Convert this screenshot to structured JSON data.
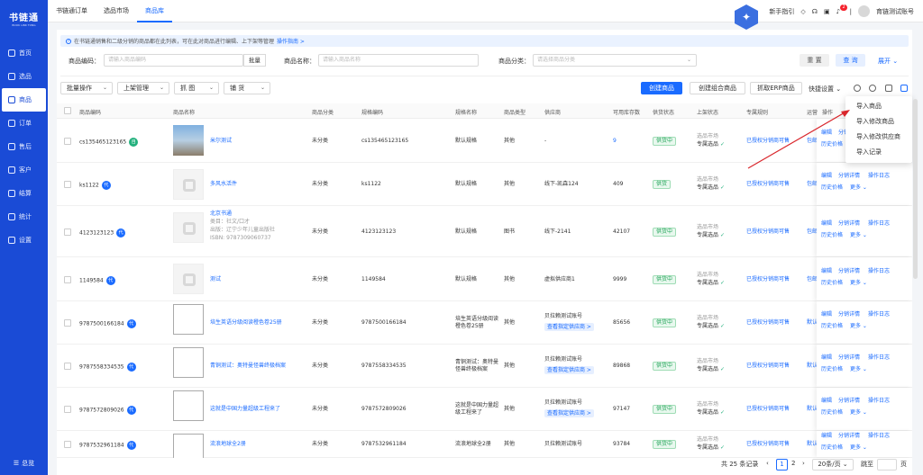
{
  "sidebar": {
    "logo_title": "书链通",
    "logo_sub": "BOOK LINK TONG",
    "items": [
      {
        "label": "首页",
        "icon": "home-icon"
      },
      {
        "label": "选品",
        "icon": "select-icon"
      },
      {
        "label": "商品",
        "icon": "goods-icon"
      },
      {
        "label": "订单",
        "icon": "order-icon"
      },
      {
        "label": "售后",
        "icon": "aftersale-icon"
      },
      {
        "label": "客户",
        "icon": "customer-icon"
      },
      {
        "label": "结算",
        "icon": "settle-icon"
      },
      {
        "label": "统计",
        "icon": "stats-icon"
      },
      {
        "label": "设置",
        "icon": "settings-icon"
      }
    ],
    "active": "商品",
    "bottom_label": "总览"
  },
  "topbar": {
    "tabs": [
      "书链通订单",
      "选品市场",
      "商品库"
    ],
    "active_tab": "商品库",
    "guide": "新手指引",
    "badge": "2",
    "account": "育链测试账号"
  },
  "notice": {
    "text": "在书链通销售和二级分销的商品都在此列表，可在此对商品进行编辑、上下架等管理",
    "link": "操作指南 >"
  },
  "filters": {
    "code_label": "商品编码：",
    "code_placeholder": "请输入商品编码",
    "batch": "批量",
    "name_label": "商品名称：",
    "name_placeholder": "请输入商品名称",
    "cat_label": "商品分类：",
    "cat_placeholder": "请选择商品分类",
    "reset": "重 置",
    "query": "查 询",
    "expand": "展开"
  },
  "toolbar": {
    "batch_ops": "批量操作",
    "shelf": "上架管理",
    "grab": "抓 图",
    "copy": "铺 货",
    "create": "创建商品",
    "create_combo": "创建组合商品",
    "grab_erp": "抓取ERP商品",
    "quick": "快捷设置"
  },
  "table": {
    "headers": [
      "商品编码",
      "商品名称",
      "商品分类",
      "规格编码",
      "规格名称",
      "商品类型",
      "供应商",
      "可用库存数",
      "供货状态",
      "上架状态",
      "专属规则",
      "运营",
      "操作"
    ],
    "rows": [
      {
        "code": "cs135465123165",
        "dai": "自",
        "dai_color": "green",
        "thumb": "real",
        "name": "米尔测试",
        "cat": "未分类",
        "spec_code": "cs135465123165",
        "spec": "默认规格",
        "type": "其他",
        "supplier": "-",
        "supplier_tag": "",
        "stock": "9",
        "stock_link": true,
        "status": "供货中",
        "shelf1": "选品市场",
        "shelf2": "专属选品",
        "rule": "已授权分销商可售",
        "op_extra": "包邮"
      },
      {
        "code": "ks1122",
        "dai": "代",
        "thumb": "gray",
        "name": "多风水活件",
        "cat": "未分类",
        "spec_code": "ks1122",
        "spec": "默认规格",
        "type": "其他",
        "supplier": "线下-凯森124",
        "supplier_tag": "",
        "stock": "409",
        "status": "供货",
        "shelf1": "选品市场",
        "shelf2": "专属选品",
        "rule": "已授权分销商可售",
        "op_extra": "包邮"
      },
      {
        "code": "4123123123",
        "dai": "代",
        "thumb": "gray",
        "name": "北京书通",
        "name_sub": [
          "类目：社文/口才",
          "出版：辽宁少年儿童出版社",
          "ISBN: 9787309060737"
        ],
        "cat": "未分类",
        "spec_code": "4123123123",
        "spec": "默认规格",
        "type": "图书",
        "supplier": "线下-2141",
        "supplier_tag": "",
        "stock": "42107",
        "status": "供货中",
        "shelf1": "选品市场",
        "shelf2": "专属选品",
        "rule": "已授权分销商可售",
        "op_extra": "包邮"
      },
      {
        "code": "1149584",
        "dai": "代",
        "thumb": "gray",
        "name": "测试",
        "cat": "未分类",
        "spec_code": "1149584",
        "spec": "默认规格",
        "type": "其他",
        "supplier": "虚拟供应商1",
        "supplier_tag": "",
        "stock": "9999",
        "status": "供货中",
        "shelf1": "选品市场",
        "shelf2": "专属选品",
        "rule": "已授权分销商可售",
        "op_extra": "包邮"
      },
      {
        "code": "9787500166184",
        "dai": "代",
        "thumb": "broken",
        "name": "培生英语分级阅读橙色卷25册",
        "cat": "未分类",
        "spec_code": "9787500166184",
        "spec": "培生英语分级阅读橙色卷25册",
        "type": "其他",
        "supplier": "贝拉赖测试账号",
        "supplier_tag": "查看指定供应商 >",
        "stock": "85656",
        "status": "供货中",
        "shelf1": "选品市场",
        "shelf2": "专属选品",
        "rule": "已授权分销商可售",
        "op_extra": "默认"
      },
      {
        "code": "9787558334535",
        "dai": "代",
        "thumb": "broken",
        "name": "青铜测试：奥特曼怪兽终极档案",
        "cat": "未分类",
        "spec_code": "9787558334535",
        "spec": "青铜测试：奥特曼怪兽终极档案",
        "type": "其他",
        "supplier": "贝拉赖测试账号",
        "supplier_tag": "查看指定供应商 >",
        "stock": "89868",
        "status": "供货中",
        "shelf1": "选品市场",
        "shelf2": "专属选品",
        "rule": "已授权分销商可售",
        "op_extra": "默认"
      },
      {
        "code": "9787572809026",
        "dai": "代",
        "thumb": "broken",
        "name": "这就是中国力量超级工程来了",
        "cat": "未分类",
        "spec_code": "9787572809026",
        "spec": "这就是中国力量超级工程来了",
        "type": "其他",
        "supplier": "贝拉赖测试账号",
        "supplier_tag": "查看指定供应商 >",
        "stock": "97147",
        "status": "供货中",
        "shelf1": "选品市场",
        "shelf2": "专属选品",
        "rule": "已授权分销商可售",
        "op_extra": "默认"
      },
      {
        "code": "9787532961184",
        "dai": "代",
        "thumb": "broken",
        "name": "流浪地球全2册",
        "cat": "未分类",
        "spec_code": "9787532961184",
        "spec": "流浪地球全2册",
        "type": "其他",
        "supplier": "贝拉赖测试账号",
        "supplier_tag": "",
        "stock": "93784",
        "status": "供货中",
        "shelf1": "选品市场",
        "shelf2": "专属选品",
        "rule": "已授权分销商可售",
        "op_extra": "默认"
      }
    ],
    "ops": {
      "edit": "编辑",
      "detail": "分销详情",
      "log": "操作日志",
      "history": "历史价格",
      "more": "更多"
    }
  },
  "dropdown": {
    "items": [
      "导入商品",
      "导入修改商品",
      "导入修改供应商",
      "导入记录"
    ]
  },
  "pager": {
    "total": "共 25 条记录",
    "p1": "1",
    "p2": "2",
    "size": "20条/页",
    "goto": "跳至",
    "unit": "页"
  },
  "colors": {
    "primary": "#1a6bff",
    "sidebar": "#1a4bd6",
    "arrow": "#d9262c",
    "green": "#23a55a"
  }
}
